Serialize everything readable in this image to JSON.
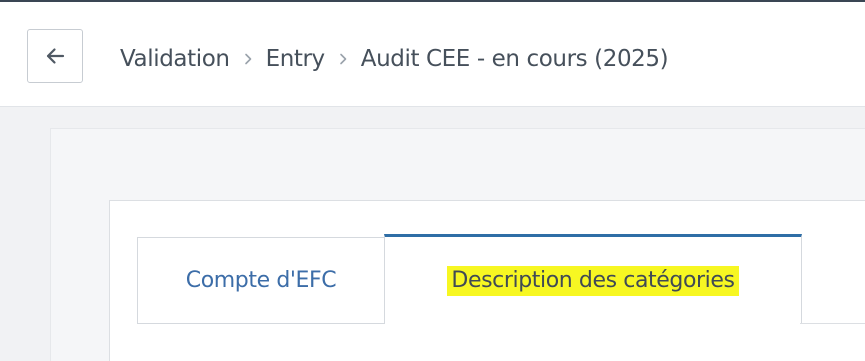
{
  "header": {
    "back_icon": "arrow-left-icon",
    "breadcrumb": {
      "items": [
        "Validation",
        "Entry",
        "Audit CEE - en cours (2025)"
      ],
      "separator_icon": "chevron-right-icon"
    }
  },
  "tabs": [
    {
      "label": "Compte d'EFC",
      "active": false
    },
    {
      "label": "Description des catégories",
      "active": true,
      "highlighted": true
    }
  ],
  "colors": {
    "tab_inactive_text": "#3c6da8",
    "tab_active_border": "#2f6ea6",
    "highlight": "#f7f722"
  }
}
